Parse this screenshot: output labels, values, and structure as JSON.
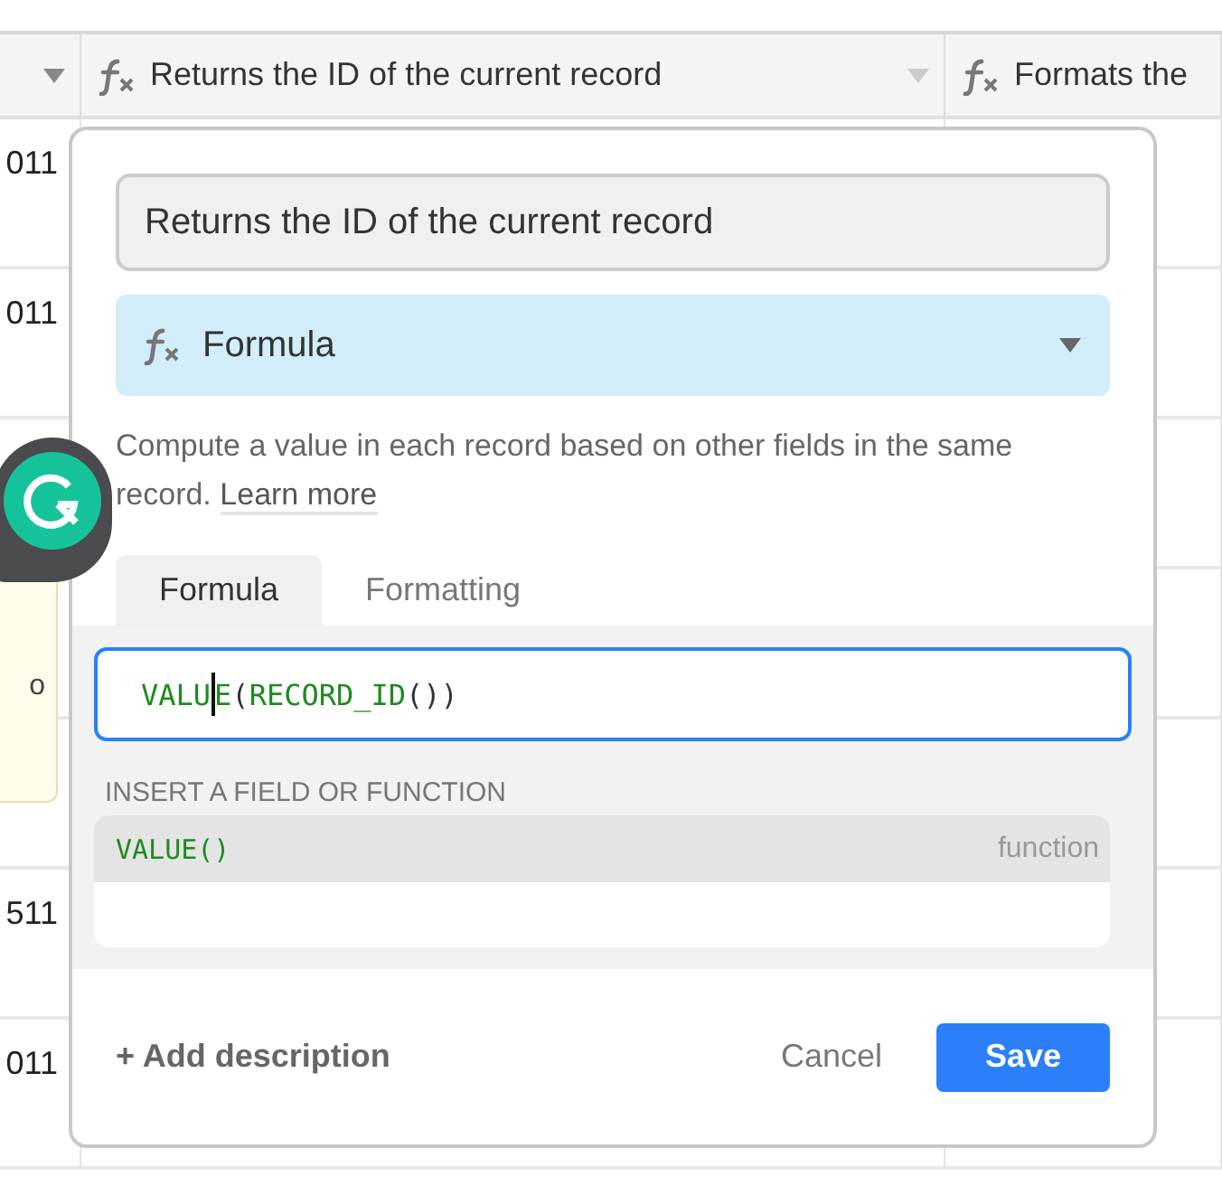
{
  "table": {
    "columns": [
      {
        "icon": false
      },
      {
        "label": "Returns the ID of the current record",
        "icon": true
      },
      {
        "label": "Formats the",
        "icon": true
      }
    ],
    "rows": [
      {
        "cell": "011",
        "kind": "plain"
      },
      {
        "cell": "011",
        "kind": "plain"
      },
      {
        "kind": "plain"
      },
      {
        "cell": "o",
        "kind": "note"
      },
      {
        "kind": "plain"
      },
      {
        "cell": "511",
        "kind": "plain"
      },
      {
        "cell": "011",
        "kind": "plain"
      }
    ]
  },
  "field_editor": {
    "name": "Returns the ID of the current record",
    "type": "Formula",
    "description": "Compute a value in each record based on other fields in the same record.",
    "learn_more": "Learn more",
    "tabs": [
      {
        "label": "Formula",
        "selected": true
      },
      {
        "label": "Formatting",
        "selected": false
      }
    ],
    "formula": [
      {
        "kind": "function",
        "text": "VALU"
      },
      {
        "kind": "cursor"
      },
      {
        "kind": "function",
        "text": "E"
      },
      {
        "kind": "punct",
        "text": "("
      },
      {
        "kind": "function",
        "text": "RECORD_ID"
      },
      {
        "kind": "punct",
        "text": "())"
      }
    ],
    "insert_heading": "INSERT A FIELD OR FUNCTION",
    "suggestions": [
      {
        "name": "VALUE()",
        "type": "function",
        "selected": true
      }
    ],
    "add_description": "+ Add description",
    "cancel": "Cancel",
    "save": "Save"
  }
}
